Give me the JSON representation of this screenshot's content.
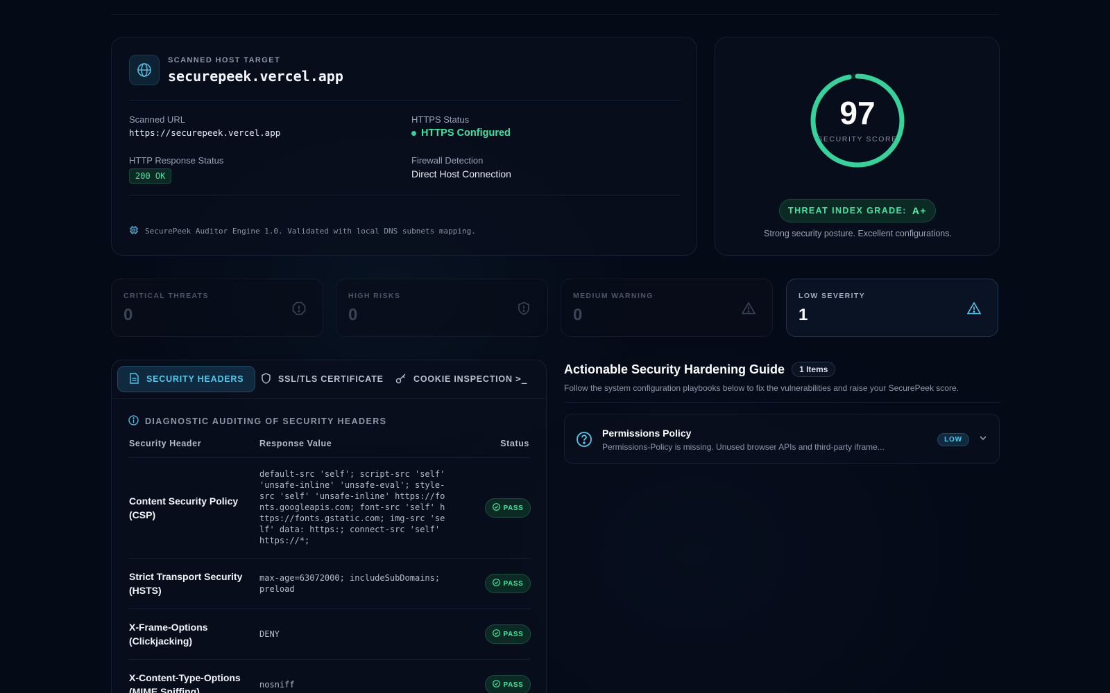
{
  "host": {
    "eyebrow": "SCANNED HOST TARGET",
    "hostname": "securepeek.vercel.app",
    "scanned_url_label": "Scanned URL",
    "scanned_url": "https://securepeek.vercel.app",
    "https_label": "HTTPS Status",
    "https_value": "HTTPS Configured",
    "http_label": "HTTP Response Status",
    "http_value": "200 OK",
    "firewall_label": "Firewall Detection",
    "firewall_value": "Direct Host Connection",
    "footer": "SecurePeek Auditor Engine 1.0. Validated with local DNS subnets mapping."
  },
  "score": {
    "value": "97",
    "score_fraction": 0.97,
    "label": "SECURITY SCORE",
    "grade_label": "THREAT INDEX GRADE:",
    "grade": "A+",
    "posture": "Strong security posture. Excellent configurations.",
    "ring_color": "#35d399"
  },
  "stats": [
    {
      "label": "CRITICAL THREATS",
      "value": "0",
      "icon": "alert-circle-icon"
    },
    {
      "label": "HIGH RISKS",
      "value": "0",
      "icon": "shield-alert-icon"
    },
    {
      "label": "MEDIUM WARNING",
      "value": "0",
      "icon": "warning-triangle-icon"
    },
    {
      "label": "LOW SEVERITY",
      "value": "1",
      "icon": "warning-triangle-icon"
    }
  ],
  "tabs": [
    {
      "label": "SECURITY HEADERS",
      "icon": "document-icon"
    },
    {
      "label": "SSL/TLS CERTIFICATE",
      "icon": "shield-icon"
    },
    {
      "label": "COOKIE INSPECTION",
      "icon": "key-icon"
    },
    {
      "label": ">_",
      "icon": "terminal-icon"
    }
  ],
  "headers_panel": {
    "heading": "DIAGNOSTIC AUDITING OF SECURITY HEADERS",
    "columns": [
      "Security Header",
      "Response Value",
      "Status"
    ],
    "rows": [
      {
        "name": "Content Security Policy (CSP)",
        "value": "default-src 'self'; script-src 'self' 'unsafe-inline' 'unsafe-eval'; style-src 'self' 'unsafe-inline' https://fonts.googleapis.com; font-src 'self' https://fonts.gstatic.com; img-src 'self' data: https:; connect-src 'self' https://*;",
        "status": "PASS"
      },
      {
        "name": "Strict Transport Security (HSTS)",
        "value": "max-age=63072000; includeSubDomains; preload",
        "status": "PASS"
      },
      {
        "name": "X-Frame-Options (Clickjacking)",
        "value": "DENY",
        "status": "PASS"
      },
      {
        "name": "X-Content-Type-Options (MIME Sniffing)",
        "value": "nosniff",
        "status": "PASS"
      }
    ]
  },
  "guide": {
    "title": "Actionable Security Hardening Guide",
    "count": "1 Items",
    "subtitle": "Follow the system configuration playbooks below to fix the vulnerabilities and raise your SecurePeek score.",
    "items": [
      {
        "title": "Permissions Policy",
        "desc": "Permissions-Policy is missing. Unused browser APIs and third-party iframe...",
        "severity": "LOW"
      }
    ]
  }
}
